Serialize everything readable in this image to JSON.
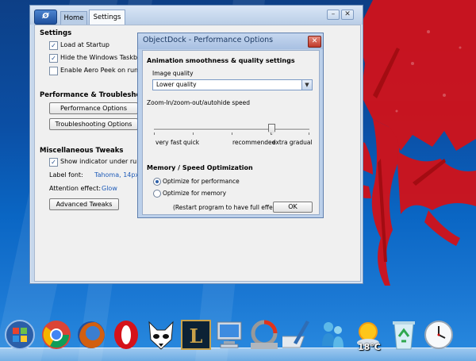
{
  "settings_window": {
    "tabs": [
      "Home",
      "Settings"
    ],
    "window_controls": {
      "minimize": "–",
      "close": "✕"
    },
    "sections": {
      "settings": {
        "heading": "Settings",
        "options": [
          {
            "label": "Load at Startup",
            "checked": true
          },
          {
            "label": "Hide the Windows Taskbar",
            "checked": true
          },
          {
            "label": "Enable Aero Peek on runnin",
            "checked": false
          }
        ]
      },
      "performance": {
        "heading": "Performance & Troubleshooting",
        "buttons": [
          "Performance Options",
          "Troubleshooting Options"
        ]
      },
      "misc": {
        "heading": "Miscellaneous Tweaks",
        "show_indicator": {
          "label": "Show indicator under runni",
          "checked": true
        },
        "label_font": {
          "label": "Label font:",
          "value": "Tahoma, 14px, Bold"
        },
        "attention_effect": {
          "label": "Attention effect:",
          "value": "Glow"
        },
        "advanced_button": "Advanced Tweaks"
      }
    }
  },
  "perf_dialog": {
    "title": "ObjectDock - Performance Options",
    "close": "✕",
    "animation_heading": "Animation smoothness & quality settings",
    "image_quality": {
      "label": "Image quality",
      "value": "Lower quality"
    },
    "zoom_label": "Zoom-In/zoom-out/autohide speed",
    "slider": {
      "labels": [
        "very fast",
        "quick",
        "recommended",
        "extra gradual"
      ],
      "value_fraction": 0.8
    },
    "memory_heading": "Memory /  Speed Optimization",
    "radios": [
      {
        "label": "Optimize for performance",
        "selected": true
      },
      {
        "label": "Optimize for memory",
        "selected": false
      }
    ],
    "restart_note": "(Restart program to have full effect)",
    "ok_label": "OK"
  },
  "dock": {
    "items": [
      "start-orb-icon",
      "chrome-icon",
      "firefox-icon",
      "opera-icon",
      "fox-mask-icon",
      "league-of-legends-icon",
      "computer-icon",
      "photoshop-icon",
      "pen-tablet-icon",
      "messenger-icon",
      "weather-icon",
      "recycle-bin-icon",
      "clock-icon"
    ],
    "weather_temp": "18°C"
  }
}
